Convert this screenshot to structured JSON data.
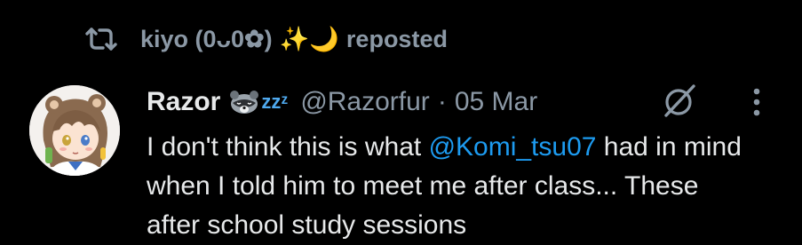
{
  "repost_bar": {
    "reposter_name": "kiyo (0ᴗ0✿)",
    "emojis": "✨🌙",
    "action": "reposted",
    "icon": "repost-icon"
  },
  "post": {
    "author_name": "Razor",
    "author_emoji": "raccoon-sleeping-emoji",
    "author_emoji_text": "zzᶻ",
    "handle": "@Razorfur",
    "separator": "·",
    "date": "05 Mar",
    "text_before_mention": "I don't think this is what ",
    "mention": "@Komi_tsu07",
    "text_after_mention": " had in mind when I told him to meet me after class... These after school study sessions",
    "grok_icon": "grok-icon",
    "more_icon": "more-icon"
  },
  "colors": {
    "background": "#000000",
    "primary_text": "#e7e9ea",
    "secondary_text": "#8b98a5",
    "link": "#1d9bf0"
  }
}
